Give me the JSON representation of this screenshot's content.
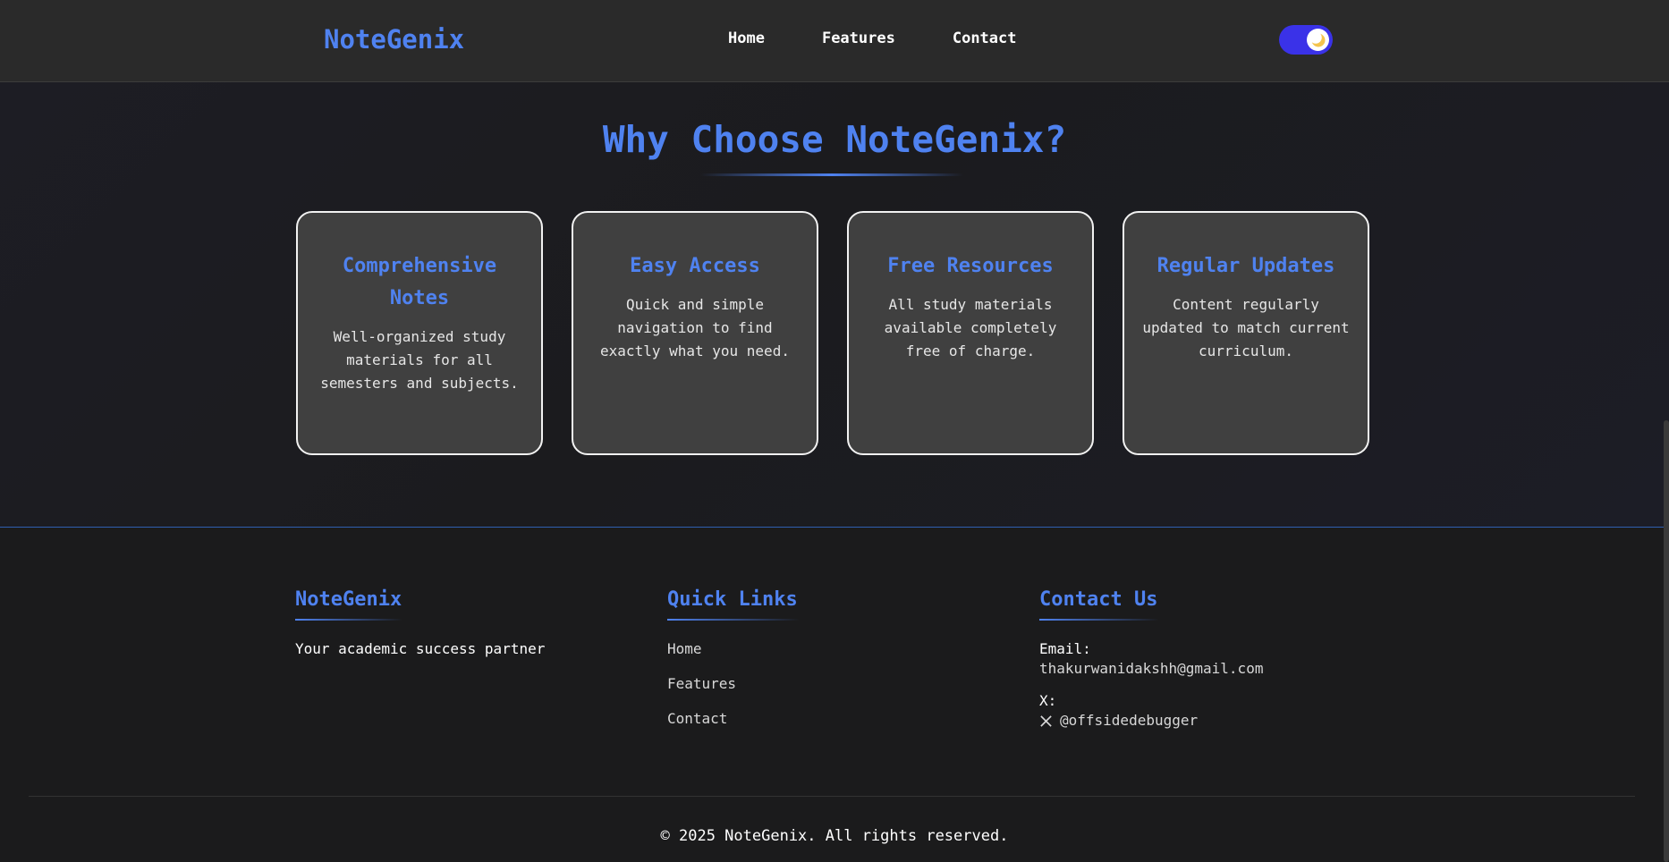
{
  "header": {
    "brand": "NoteGenix",
    "nav": [
      {
        "label": "Home"
      },
      {
        "label": "Features"
      },
      {
        "label": "Contact"
      }
    ],
    "theme_toggle_icon": "moon-icon"
  },
  "features": {
    "title": "Why Choose NoteGenix?",
    "cards": [
      {
        "title": "Comprehensive Notes",
        "text": "Well-organized study materials for all semesters and subjects."
      },
      {
        "title": "Easy Access",
        "text": "Quick and simple navigation to find exactly what you need."
      },
      {
        "title": "Free Resources",
        "text": "All study materials available completely free of charge."
      },
      {
        "title": "Regular Updates",
        "text": "Content regularly updated to match current curriculum."
      }
    ]
  },
  "footer": {
    "brand": {
      "title": "NoteGenix",
      "tagline": "Your academic success partner"
    },
    "quick_links": {
      "title": "Quick Links",
      "links": [
        {
          "label": "Home"
        },
        {
          "label": "Features"
        },
        {
          "label": "Contact"
        }
      ]
    },
    "contact": {
      "title": "Contact Us",
      "email_label": "Email:",
      "email": "thakurwanidakshh@gmail.com",
      "x_label": "X:",
      "x_handle": "@offsidedebugger",
      "x_icon": "x-logo-icon"
    },
    "copyright": "© 2025 NoteGenix. All rights reserved."
  },
  "colors": {
    "accent": "#4f82f0",
    "toggle": "#3a32e8",
    "card_bg": "#404040",
    "page_bg": "#1b1b1c"
  }
}
